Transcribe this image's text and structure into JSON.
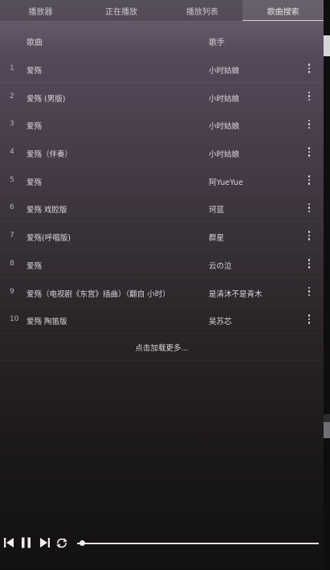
{
  "tabs": [
    {
      "label": "播放器"
    },
    {
      "label": "正在播放"
    },
    {
      "label": "播放列表"
    },
    {
      "label": "歌曲搜索",
      "active": true
    }
  ],
  "list_header": {
    "song": "歌曲",
    "artist": "歌手"
  },
  "songs": [
    {
      "index": "1",
      "title": "爱殇",
      "artist": "小时姑娘"
    },
    {
      "index": "2",
      "title": "爱殇 (男版)",
      "artist": "小时姑娘"
    },
    {
      "index": "3",
      "title": "爱殇",
      "artist": "小时姑娘"
    },
    {
      "index": "4",
      "title": "爱殇（伴奏）",
      "artist": "小时姑娘"
    },
    {
      "index": "5",
      "title": "爱殇",
      "artist": "阿YueYue"
    },
    {
      "index": "6",
      "title": "爱殇 戏腔版",
      "artist": "珂蓝"
    },
    {
      "index": "7",
      "title": "爱殇(呼唱版)",
      "artist": "群星"
    },
    {
      "index": "8",
      "title": "爱殇",
      "artist": "云の泣"
    },
    {
      "index": "9",
      "title": "爱殇（电视剧《东宫》插曲）（翻自 小时）",
      "artist": "是清沐不是青木"
    },
    {
      "index": "10",
      "title": "爱殇 陶笛版",
      "artist": "吴苏芯"
    }
  ],
  "load_more_label": "点击加载更多...",
  "player": {
    "progress": 0.02,
    "icons": [
      "skip-previous-icon",
      "pause-icon",
      "skip-next-icon",
      "repeat-icon"
    ]
  }
}
